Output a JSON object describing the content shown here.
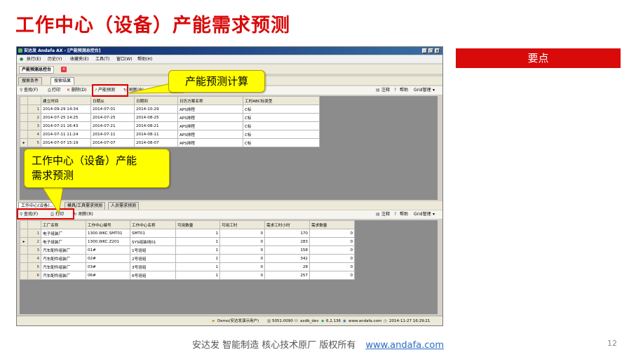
{
  "slide": {
    "title": "工作中心（设备）产能需求预测",
    "key_points": "要点",
    "footer_text": "安达发   智能制造 核心技术原厂   版权所有",
    "footer_link": "www.andafa.com",
    "page_number": "12",
    "callout_top": "产能预测计算",
    "callout_bottom_line1": "工作中心（设备）产能",
    "callout_bottom_line2": "需求预测"
  },
  "window": {
    "title": "安达发 Andafa AX - [产能预测总控台]",
    "menu": [
      "执行(E)",
      "历史(Y)",
      "收藏夹(E)",
      "工具(T)",
      "窗口(W)",
      "帮助(H)"
    ],
    "doc_tab": "产能预测总控台",
    "search_tabs": [
      "搜索条件",
      "搜索结果"
    ],
    "toolbar_top": {
      "find": "查找(F)",
      "print": "打印",
      "delete": "删除(D)",
      "forecast": "产能预测",
      "refresh": "刷新(R)"
    },
    "toolbar_right": {
      "note": "注释",
      "help": "帮助",
      "grid": "Grid管理"
    },
    "toolbar_bottom": {
      "find": "查找(F)",
      "print": "打印",
      "refresh": "刷新(R)"
    },
    "bottom_tabs": [
      "工作中心(设备)...",
      "模具/工具需求预测",
      "人员需求预测"
    ]
  },
  "top_grid": {
    "headers": [
      "建立时间",
      "日期从",
      "日期到",
      "日历方案名称",
      "工时ABC标类型"
    ],
    "rows": [
      [
        "1",
        "2014-09-29 14:34",
        "2014-07-01",
        "2014-10-29",
        "APS排程",
        "C标"
      ],
      [
        "2",
        "2014-07-25 14:25",
        "2014-07-25",
        "2014-08-25",
        "APS排程",
        "C标"
      ],
      [
        "3",
        "2014-07-21 16:43",
        "2014-07-21",
        "2014-08-21",
        "APS排程",
        "C标"
      ],
      [
        "4",
        "2014-07-11 11:24",
        "2014-07-11",
        "2014-08-11",
        "APS排程",
        "C标"
      ],
      [
        "5",
        "2014-07-07 15:19",
        "2014-07-07",
        "2014-08-07",
        "APS排程",
        "C标"
      ]
    ]
  },
  "bottom_grid": {
    "headers": [
      "工厂名称",
      "工作中心编号",
      "工作中心名称",
      "可用数量",
      "可用工时",
      "需求工时小时",
      "需求数量"
    ],
    "rows": [
      [
        "1",
        "电子组装厂",
        "1300.WKC.SMT01",
        "SMT01",
        "1",
        "0",
        "170",
        "0"
      ],
      [
        "2",
        "电子组装厂",
        "1300.WKC.Z201",
        "SYS组装线01",
        "1",
        "0",
        "283",
        "0"
      ],
      [
        "3",
        "汽车配件组装厂",
        "01#",
        "1号班组",
        "1",
        "0",
        "158",
        "0"
      ],
      [
        "4",
        "汽车配件组装厂",
        "02#",
        "2号班组",
        "1",
        "0",
        "342",
        "0"
      ],
      [
        "5",
        "汽车配件组装厂",
        "03#",
        "3号班组",
        "1",
        "0",
        "28",
        "0"
      ],
      [
        "6",
        "汽车配件组装厂",
        "06#",
        "6号班组",
        "1",
        "0",
        "257",
        "0"
      ]
    ]
  },
  "status_bar": {
    "user": "Demo(安达发演示用户)",
    "port": "5051:0090",
    "db": "axdb_dev",
    "version": "6.2.136",
    "site": "www.andafa.com",
    "datetime": "2014-11-27 16:29:21"
  }
}
